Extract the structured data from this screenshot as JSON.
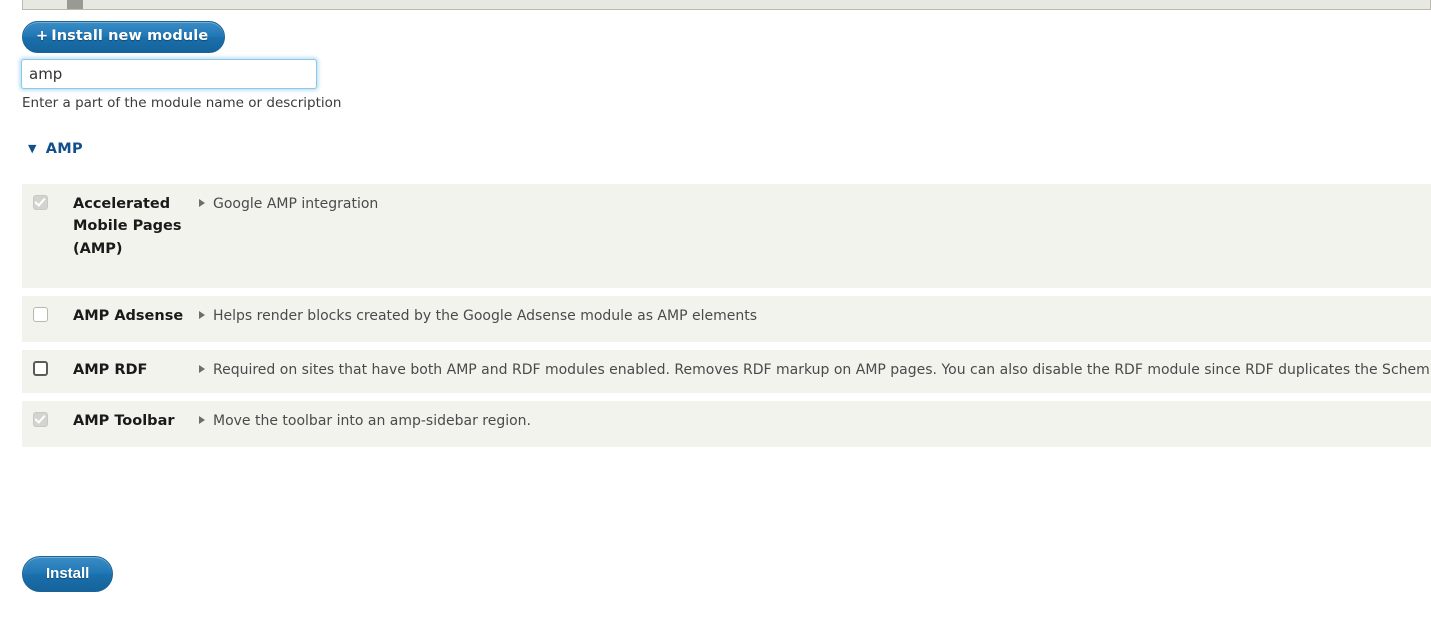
{
  "toolbar": {
    "install_new_module_label": "Install new module",
    "install_new_module_plus": "+"
  },
  "filter": {
    "value": "amp",
    "placeholder": "",
    "description": "Enter a part of the module name or description"
  },
  "package": {
    "caret": "▼",
    "name": "AMP"
  },
  "table": {
    "rows": [
      {
        "name": "Accelerated Mobile Pages (AMP)",
        "description": "Google AMP integration",
        "checkbox": {
          "checked": true,
          "disabled": true,
          "focused": false
        }
      },
      {
        "name": "AMP Adsense",
        "description": "Helps render blocks created by the Google Adsense module as AMP elements",
        "checkbox": {
          "checked": false,
          "disabled": false,
          "focused": false
        }
      },
      {
        "name": "AMP RDF",
        "description": "Required on sites that have both AMP and RDF modules enabled. Removes RDF markup on AMP pages. You can also disable the RDF module since RDF duplicates the Schem",
        "checkbox": {
          "checked": false,
          "disabled": false,
          "focused": true
        }
      },
      {
        "name": "AMP Toolbar",
        "description": "Move the toolbar into an amp-sidebar region.",
        "checkbox": {
          "checked": true,
          "disabled": true,
          "focused": false
        }
      }
    ]
  },
  "actions": {
    "submit_label": "Install"
  },
  "colors": {
    "accent_blue": "#2077b5",
    "heading_blue": "#12508b",
    "row_background": "#f3f3ee",
    "page_background": "#ffffff",
    "focus_glow": "#8ec7e8"
  }
}
